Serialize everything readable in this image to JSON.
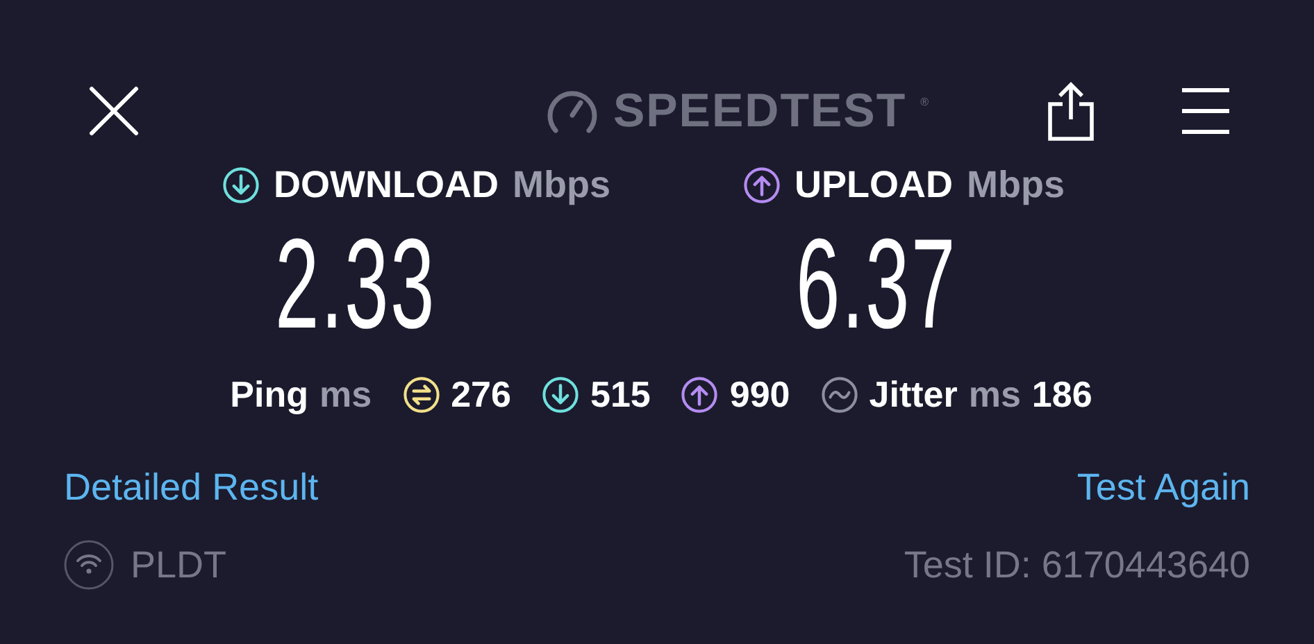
{
  "header": {
    "logo": "SPEEDTEST",
    "trademark": "®"
  },
  "results": [
    {
      "kind": "download",
      "label": "DOWNLOAD",
      "unit": "Mbps",
      "value": "2.33"
    },
    {
      "kind": "upload",
      "label": "UPLOAD",
      "unit": "Mbps",
      "value": "6.37"
    }
  ],
  "stats": [
    {
      "kind": "label",
      "text": "Ping",
      "unit": "ms"
    },
    {
      "kind": "ping",
      "value": "276"
    },
    {
      "kind": "download",
      "value": "515"
    },
    {
      "kind": "upload",
      "value": "990"
    },
    {
      "kind": "jitter",
      "text": "Jitter",
      "unit": "ms",
      "value": "186"
    }
  ],
  "links": [
    "Detailed Result",
    "Test Again"
  ],
  "footer": {
    "provider": "PLDT",
    "test_id": "Test ID: 6170443640"
  }
}
